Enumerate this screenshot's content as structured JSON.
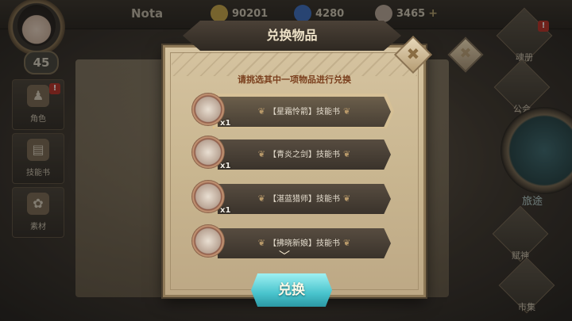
{
  "header": {
    "player_name": "Nota",
    "level": "45",
    "resources": [
      {
        "name": "gold-coin-icon",
        "value": "90201",
        "color": "#c6a64a"
      },
      {
        "name": "crystal-icon",
        "value": "4280",
        "color": "#3e6fbf"
      },
      {
        "name": "stamina-icon",
        "value": "3465",
        "color": "#b9a89a"
      }
    ],
    "plus_symbol": "+"
  },
  "left_menu": [
    {
      "label": "角色",
      "badge": "!"
    },
    {
      "label": "技能书"
    },
    {
      "label": "素材"
    }
  ],
  "right_menu": [
    {
      "label": "魂册",
      "badge": "!"
    },
    {
      "label": "公会"
    },
    {
      "label": "旅途"
    },
    {
      "label": "赋神"
    },
    {
      "label": "市集"
    }
  ],
  "dialog": {
    "title": "兑换物品",
    "subtitle": "请挑选其中一项物品进行兑换",
    "items": [
      {
        "name": "【星霜怜箭】技能书",
        "qty": "x1",
        "selected": true
      },
      {
        "name": "【青炎之剑】技能书",
        "qty": "x1",
        "selected": false
      },
      {
        "name": "【湛蓝猎师】技能书",
        "qty": "x1",
        "selected": false
      },
      {
        "name": "【拂晓新娘】技能书",
        "qty": "",
        "selected": false
      }
    ],
    "confirm_label": "兑换",
    "close_symbol": "✖"
  },
  "colors": {
    "accent_teal": "#49c4cd",
    "title_brown": "#7a3f1d",
    "selection_glow": "#ffc85a"
  }
}
